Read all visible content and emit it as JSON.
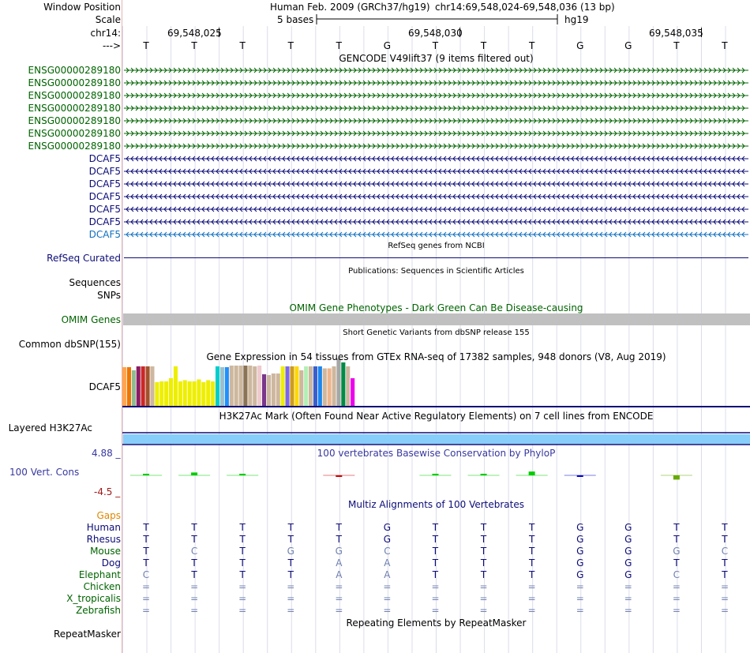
{
  "header": {
    "window_position_label": "Window Position",
    "assembly": "Human Feb. 2009 (GRCh37/hg19)",
    "position": "chr14:69,548,024-69,548,036 (13 bp)",
    "scale_label": "Scale",
    "scale_text": "5 bases",
    "db": "hg19",
    "chrom_label": "chr14:",
    "strand_label": "--->",
    "ticks": [
      "69,548,025",
      "69,548,030",
      "69,548,035"
    ]
  },
  "sequence": [
    "T",
    "T",
    "T",
    "T",
    "T",
    "G",
    "T",
    "T",
    "T",
    "G",
    "G",
    "T",
    "T"
  ],
  "gencode": {
    "title": "GENCODE V49lift37 (9 items filtered out)",
    "rows": [
      {
        "name": "ENSG00000289180",
        "dir": "right",
        "color": "#006400"
      },
      {
        "name": "ENSG00000289180",
        "dir": "right",
        "color": "#006400"
      },
      {
        "name": "ENSG00000289180",
        "dir": "right",
        "color": "#006400"
      },
      {
        "name": "ENSG00000289180",
        "dir": "right",
        "color": "#006400"
      },
      {
        "name": "ENSG00000289180",
        "dir": "right",
        "color": "#006400"
      },
      {
        "name": "ENSG00000289180",
        "dir": "right",
        "color": "#006400"
      },
      {
        "name": "ENSG00000289180",
        "dir": "right",
        "color": "#006400"
      },
      {
        "name": "DCAF5",
        "dir": "left",
        "color": "#0c0c78"
      },
      {
        "name": "DCAF5",
        "dir": "left",
        "color": "#0c0c78"
      },
      {
        "name": "DCAF5",
        "dir": "left",
        "color": "#0c0c78"
      },
      {
        "name": "DCAF5",
        "dir": "left",
        "color": "#0c0c78"
      },
      {
        "name": "DCAF5",
        "dir": "left",
        "color": "#0c0c78"
      },
      {
        "name": "DCAF5",
        "dir": "left",
        "color": "#0c0c78"
      },
      {
        "name": "DCAF5",
        "dir": "left",
        "color": "#1070c0"
      }
    ]
  },
  "refseq": {
    "title": "RefSeq genes from NCBI",
    "label": "RefSeq Curated"
  },
  "publications": {
    "title": "Publications: Sequences in Scientific Articles",
    "label_seq": "Sequences",
    "label_snps": "SNPs"
  },
  "omim": {
    "title": "OMIM Gene Phenotypes - Dark Green Can Be Disease-causing",
    "label": "OMIM Genes",
    "bar_color": "#c0c0c0"
  },
  "dbsnp": {
    "title": "Short Genetic Variants from dbSNP release 155",
    "label": "Common dbSNP(155)"
  },
  "gtex": {
    "title": "Gene Expression in 54 tissues from GTEx RNA-seq of 17382 samples, 948 donors (V8, Aug 2019)",
    "label": "DCAF5",
    "bars": [
      {
        "c": "#ffa54f",
        "v": 0.98
      },
      {
        "c": "#ee7600",
        "v": 0.98
      },
      {
        "c": "#8fbc8f",
        "v": 0.9
      },
      {
        "c": "#8b1c62",
        "v": 1.0
      },
      {
        "c": "#cd2626",
        "v": 1.0
      },
      {
        "c": "#a0522d",
        "v": 1.0
      },
      {
        "c": "#cdb79e",
        "v": 1.0
      },
      {
        "c": "#eeee00",
        "v": 0.6
      },
      {
        "c": "#eeee00",
        "v": 0.62
      },
      {
        "c": "#eeee00",
        "v": 0.62
      },
      {
        "c": "#eeee00",
        "v": 0.7
      },
      {
        "c": "#eeee00",
        "v": 1.0
      },
      {
        "c": "#eeee00",
        "v": 0.62
      },
      {
        "c": "#eeee00",
        "v": 0.65
      },
      {
        "c": "#eeee00",
        "v": 0.62
      },
      {
        "c": "#eeee00",
        "v": 0.62
      },
      {
        "c": "#eeee00",
        "v": 0.67
      },
      {
        "c": "#eeee00",
        "v": 0.6
      },
      {
        "c": "#eeee00",
        "v": 0.65
      },
      {
        "c": "#eeee00",
        "v": 0.62
      },
      {
        "c": "#00cdcd",
        "v": 1.0
      },
      {
        "c": "#9ac0cd",
        "v": 0.98
      },
      {
        "c": "#1e90ff",
        "v": 0.98
      },
      {
        "c": "#cdb79e",
        "v": 1.02
      },
      {
        "c": "#cdb79e",
        "v": 1.02
      },
      {
        "c": "#cdb79e",
        "v": 1.02
      },
      {
        "c": "#8b7355",
        "v": 1.02
      },
      {
        "c": "#cdb79e",
        "v": 1.02
      },
      {
        "c": "#cdb79e",
        "v": 1.0
      },
      {
        "c": "#eec9cd",
        "v": 1.02
      },
      {
        "c": "#7a378b",
        "v": 0.8
      },
      {
        "c": "#cdb79e",
        "v": 0.78
      },
      {
        "c": "#cdb79e",
        "v": 0.82
      },
      {
        "c": "#cdb79e",
        "v": 0.82
      },
      {
        "c": "#eeee00",
        "v": 1.0
      },
      {
        "c": "#7a67ee",
        "v": 1.0
      },
      {
        "c": "#cd9b1d",
        "v": 1.0
      },
      {
        "c": "#ffd700",
        "v": 1.0
      },
      {
        "c": "#cdb79e",
        "v": 0.9
      },
      {
        "c": "#b4eeb4",
        "v": 1.0
      },
      {
        "c": "#cdb79e",
        "v": 1.0
      },
      {
        "c": "#3a5fcd",
        "v": 1.0
      },
      {
        "c": "#1c86ee",
        "v": 1.0
      },
      {
        "c": "#cdb79e",
        "v": 0.95
      },
      {
        "c": "#eeb48c",
        "v": 0.95
      },
      {
        "c": "#cdb79e",
        "v": 1.0
      },
      {
        "c": "#a6a6a6",
        "v": 1.2
      },
      {
        "c": "#008b45",
        "v": 1.1
      },
      {
        "c": "#cdb79e",
        "v": 1.0
      },
      {
        "c": "#ee00ee",
        "v": 0.7
      }
    ]
  },
  "h3k27ac": {
    "title": "H3K27Ac Mark (Often Found Near Active Regulatory Elements) on 7 cell lines from ENCODE",
    "label": "Layered H3K27Ac",
    "bar_color": "#87cefa"
  },
  "phylop": {
    "title": "100 vertebrates Basewise Conservation by PhyloP",
    "label": "100 Vert. Cons",
    "ymax": "4.88 _",
    "ymin": "-4.5 _",
    "marks": [
      {
        "col": 0,
        "c": "#00cc00",
        "v": 0.2
      },
      {
        "col": 1,
        "c": "#00cc00",
        "v": 0.6
      },
      {
        "col": 2,
        "c": "#00cc00",
        "v": 0.3
      },
      {
        "col": 4,
        "c": "#cc0000",
        "v": -0.1
      },
      {
        "col": 6,
        "c": "#00cc00",
        "v": 0.1
      },
      {
        "col": 7,
        "c": "#00cc00",
        "v": 0.3
      },
      {
        "col": 8,
        "c": "#00cc00",
        "v": 0.8
      },
      {
        "col": 9,
        "c": "#0000cc",
        "v": -0.2
      },
      {
        "col": 11,
        "c": "#66aa00",
        "v": -0.9
      }
    ]
  },
  "multiz": {
    "title": "Multiz Alignments of 100 Vertebrates",
    "gaps_label": "Gaps",
    "species": [
      {
        "name": "Human",
        "color": "#0c0c78",
        "bases": [
          "T",
          "T",
          "T",
          "T",
          "T",
          "G",
          "T",
          "T",
          "T",
          "G",
          "G",
          "T",
          "T"
        ]
      },
      {
        "name": "Rhesus",
        "color": "#0c0c78",
        "bases": [
          "T",
          "T",
          "T",
          "T",
          "T",
          "G",
          "T",
          "T",
          "T",
          "G",
          "G",
          "T",
          "T"
        ]
      },
      {
        "name": "Mouse",
        "color": "#006400",
        "bases": [
          "T",
          "C",
          "T",
          "G",
          "G",
          "C",
          "T",
          "T",
          "T",
          "G",
          "G",
          "G",
          "C"
        ]
      },
      {
        "name": "Dog",
        "color": "#0c0c78",
        "bases": [
          "T",
          "T",
          "T",
          "T",
          "A",
          "A",
          "T",
          "T",
          "T",
          "G",
          "G",
          "T",
          "T"
        ]
      },
      {
        "name": "Elephant",
        "color": "#006400",
        "bases": [
          "C",
          "T",
          "T",
          "T",
          "A",
          "A",
          "T",
          "T",
          "T",
          "G",
          "G",
          "C",
          "T"
        ]
      },
      {
        "name": "Chicken",
        "color": "#006400",
        "bases": [
          "=",
          "=",
          "=",
          "=",
          "=",
          "=",
          "=",
          "=",
          "=",
          "=",
          "=",
          "=",
          "="
        ]
      },
      {
        "name": "X_tropicalis",
        "color": "#006400",
        "bases": [
          "=",
          "=",
          "=",
          "=",
          "=",
          "=",
          "=",
          "=",
          "=",
          "=",
          "=",
          "=",
          "="
        ]
      },
      {
        "name": "Zebrafish",
        "color": "#006400",
        "bases": [
          "=",
          "=",
          "=",
          "=",
          "=",
          "=",
          "=",
          "=",
          "=",
          "=",
          "=",
          "=",
          "="
        ]
      }
    ]
  },
  "repeatmasker": {
    "title": "Repeating Elements by RepeatMasker",
    "label": "RepeatMasker"
  }
}
